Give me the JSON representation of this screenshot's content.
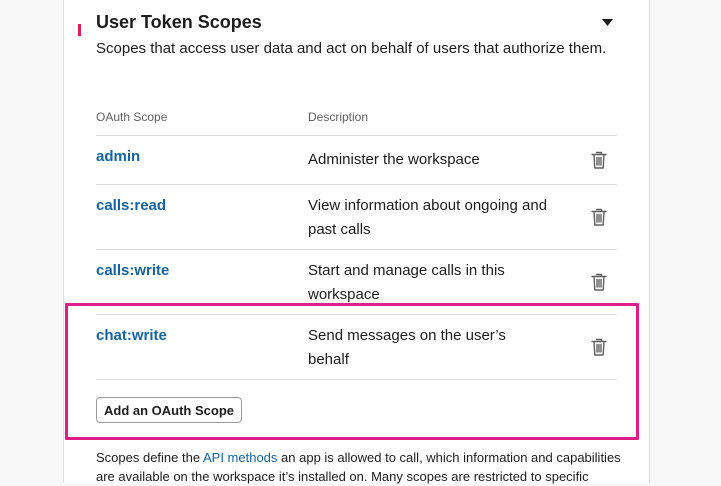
{
  "section": {
    "title": "User Token Scopes",
    "subtitle": "Scopes that access user data and act on behalf of users that authorize them.",
    "toggle_icon": "caret-down-icon"
  },
  "table": {
    "headers": {
      "scope": "OAuth Scope",
      "description": "Description"
    },
    "rows": [
      {
        "scope": "admin",
        "description": "Administer the workspace"
      },
      {
        "scope": "calls:read",
        "description": "View information about ongoing and past calls"
      },
      {
        "scope": "calls:write",
        "description": "Start and manage calls in this workspace"
      },
      {
        "scope": "chat:write",
        "description": "Send messages on the user’s behalf"
      }
    ],
    "row_action_icon": "trash-icon"
  },
  "actions": {
    "add_scope_label": "Add an OAuth Scope"
  },
  "footer": {
    "text_before": "Scopes define the ",
    "link_text": "API methods",
    "text_after": " an app is allowed to call, which information and capabilities are available on the workspace it’s installed on. Many scopes are restricted to specific"
  },
  "colors": {
    "accent": "#e01e5a",
    "highlight": "#e01e8a",
    "link": "#1264a3"
  }
}
